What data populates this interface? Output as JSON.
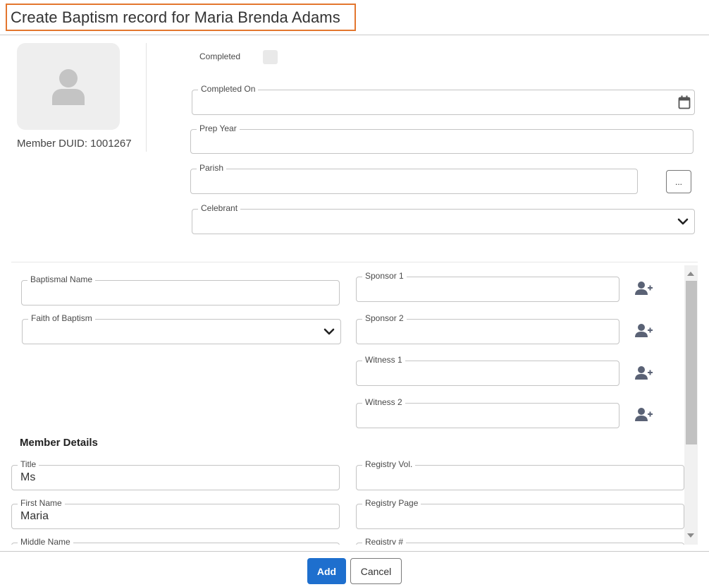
{
  "dialog": {
    "title": "Create Baptism record for Maria Brenda Adams"
  },
  "member": {
    "duid_text": "Member DUID: 1001267"
  },
  "record": {
    "completed_label": "Completed",
    "completed_checked": false,
    "completed_on_label": "Completed On",
    "completed_on_value": "",
    "prep_year_label": "Prep Year",
    "prep_year_value": "",
    "parish_label": "Parish",
    "parish_value": "",
    "parish_lookup_label": "...",
    "celebrant_label": "Celebrant",
    "celebrant_value": ""
  },
  "baptism": {
    "baptismal_name_label": "Baptismal Name",
    "baptismal_name_value": "",
    "faith_label": "Faith of Baptism",
    "faith_value": "",
    "sponsor1_label": "Sponsor 1",
    "sponsor2_label": "Sponsor 2",
    "witness1_label": "Witness 1",
    "witness2_label": "Witness 2"
  },
  "member_details": {
    "section_title": "Member Details",
    "title_label": "Title",
    "title_value": "Ms",
    "first_name_label": "First Name",
    "first_name_value": "Maria",
    "middle_name_label": "Middle Name",
    "registry_vol_label": "Registry Vol.",
    "registry_page_label": "Registry Page",
    "registry_num_label": "Registry #"
  },
  "footer": {
    "add_label": "Add",
    "cancel_label": "Cancel"
  },
  "colors": {
    "title_highlight": "#e3762e",
    "primary_button": "#1e6fce"
  },
  "icons": {
    "avatar": "person-placeholder-icon",
    "calendar": "calendar-icon",
    "dropdown": "chevron-down-icon",
    "add_person": "user-plus-icon"
  }
}
